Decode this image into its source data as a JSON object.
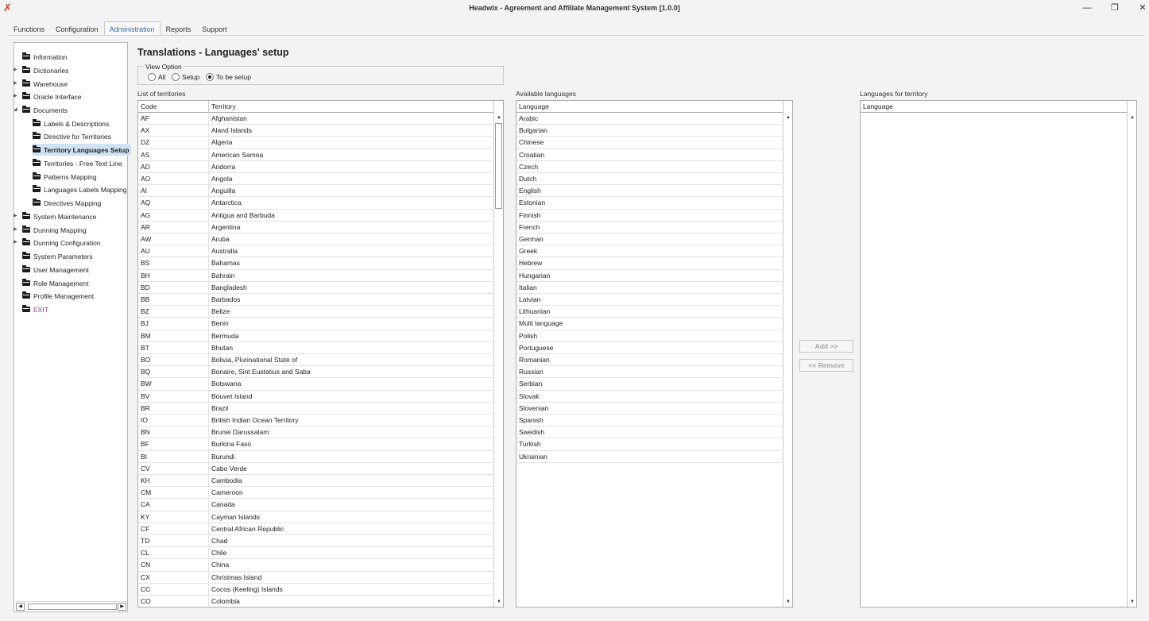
{
  "window": {
    "title": "Headwix - Agreement and Affiliate Management System [1.0.0]",
    "app_icon": "✗",
    "minimize": "—",
    "restore": "❐",
    "close": "✕"
  },
  "menu": [
    "Functions",
    "Configuration",
    "Administration",
    "Reports",
    "Support"
  ],
  "active_menu": "Administration",
  "tree": [
    {
      "label": "Information",
      "level": 0,
      "arrow": false
    },
    {
      "label": "Dictionaries",
      "level": 0,
      "arrow": true
    },
    {
      "label": "Warehouse",
      "level": 0,
      "arrow": true
    },
    {
      "label": "Oracle Interface",
      "level": 0,
      "arrow": true
    },
    {
      "label": "Documents",
      "level": 0,
      "arrow": true,
      "expanded": true
    },
    {
      "label": "Labels & Descriptions",
      "level": 1
    },
    {
      "label": "Directive for Territories",
      "level": 1
    },
    {
      "label": "Territory Languages Setup",
      "level": 1,
      "selected": true
    },
    {
      "label": "Territories - Free Text Line",
      "level": 1
    },
    {
      "label": "Patterns Mapping",
      "level": 1
    },
    {
      "label": "Languages Labels Mapping",
      "level": 1
    },
    {
      "label": "Directives Mapping",
      "level": 1
    },
    {
      "label": "System Maintenance",
      "level": 0,
      "arrow": true
    },
    {
      "label": "Dunning Mapping",
      "level": 0,
      "arrow": true
    },
    {
      "label": "Dunning Configuration",
      "level": 0,
      "arrow": true
    },
    {
      "label": "System Parameters",
      "level": 0
    },
    {
      "label": "User Management",
      "level": 0
    },
    {
      "label": "Role Management",
      "level": 0
    },
    {
      "label": "Profile Management",
      "level": 0
    },
    {
      "label": "EXIT",
      "level": 0,
      "exit": true
    }
  ],
  "page": {
    "heading": "Translations - Languages' setup",
    "view_option": {
      "label": "View Option",
      "options": [
        "All",
        "Setup",
        "To be setup"
      ],
      "selected": "To be setup"
    }
  },
  "territories": {
    "label": "List of territories",
    "columns": [
      "Code",
      "Territory"
    ],
    "rows": [
      [
        "AF",
        "Afghanistan"
      ],
      [
        "AX",
        "Aland Islands"
      ],
      [
        "DZ",
        "Algeria"
      ],
      [
        "AS",
        "American Samoa"
      ],
      [
        "AD",
        "Andorra"
      ],
      [
        "AO",
        "Angola"
      ],
      [
        "AI",
        "Anguilla"
      ],
      [
        "AQ",
        "Antarctica"
      ],
      [
        "AG",
        "Antigua and Barbuda"
      ],
      [
        "AR",
        "Argentina"
      ],
      [
        "AW",
        "Aruba"
      ],
      [
        "AU",
        "Australia"
      ],
      [
        "BS",
        "Bahamas"
      ],
      [
        "BH",
        "Bahrain"
      ],
      [
        "BD",
        "Bangladesh"
      ],
      [
        "BB",
        "Barbados"
      ],
      [
        "BZ",
        "Belize"
      ],
      [
        "BJ",
        "Benin"
      ],
      [
        "BM",
        "Bermuda"
      ],
      [
        "BT",
        "Bhutan"
      ],
      [
        "BO",
        "Bolivia, Plurinational State of"
      ],
      [
        "BQ",
        "Bonaire, Sint Eustatius and Saba"
      ],
      [
        "BW",
        "Botswana"
      ],
      [
        "BV",
        "Bouvet Island"
      ],
      [
        "BR",
        "Brazil"
      ],
      [
        "IO",
        "British Indian Ocean Territory"
      ],
      [
        "BN",
        "Brunei Darussalam"
      ],
      [
        "BF",
        "Burkina Faso"
      ],
      [
        "BI",
        "Burundi"
      ],
      [
        "CV",
        "Cabo Verde"
      ],
      [
        "KH",
        "Cambodia"
      ],
      [
        "CM",
        "Cameroon"
      ],
      [
        "CA",
        "Canada"
      ],
      [
        "KY",
        "Cayman Islands"
      ],
      [
        "CF",
        "Central African Republic"
      ],
      [
        "TD",
        "Chad"
      ],
      [
        "CL",
        "Chile"
      ],
      [
        "CN",
        "China"
      ],
      [
        "CX",
        "Christmas Island"
      ],
      [
        "CC",
        "Cocos (Keeling) Islands"
      ],
      [
        "CO",
        "Colombia"
      ]
    ]
  },
  "available": {
    "label": "Available languages",
    "column": "Language",
    "rows": [
      "Arabic",
      "Bulgarian",
      "Chinese",
      "Croatian",
      "Czech",
      "Dutch",
      "English",
      "Estonian",
      "Finnish",
      "French",
      "German",
      "Greek",
      "Hebrew",
      "Hungarian",
      "Italian",
      "Latvian",
      "Lithuanian",
      "Multi language",
      "Polish",
      "Portuguese",
      "Romanian",
      "Russian",
      "Serbian",
      "Slovak",
      "Slovenian",
      "Spanish",
      "Swedish",
      "Turkish",
      "Ukrainian"
    ]
  },
  "assigned": {
    "label": "Languages for territory",
    "column": "Language",
    "rows": []
  },
  "buttons": {
    "add": "Add >>",
    "remove": "<< Remove"
  },
  "scroll": {
    "up": "▲",
    "down": "▼",
    "left": "◀",
    "right": "▶",
    "expand": "▶",
    "collapse": "◢"
  }
}
